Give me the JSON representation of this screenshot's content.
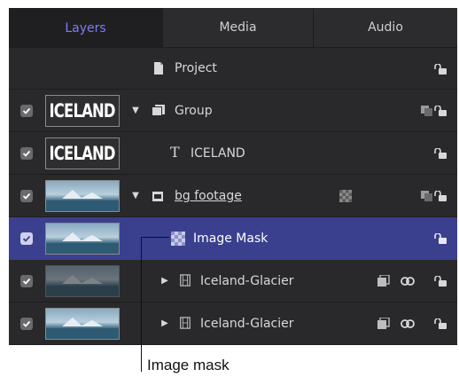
{
  "tabs": [
    {
      "label": "Layers",
      "active": true
    },
    {
      "label": "Media",
      "active": false
    },
    {
      "label": "Audio",
      "active": false
    }
  ],
  "rows": [
    {
      "name": "Project",
      "kind": "project",
      "icon": "document-icon",
      "has_checkbox": false
    },
    {
      "name": "Group",
      "kind": "group",
      "icon": "group-icon",
      "checked": true,
      "thumbnail_text": "ICELAND",
      "expanded": true
    },
    {
      "name": "ICELAND",
      "kind": "text",
      "icon": "text-layer-icon",
      "icon_glyph": "T",
      "checked": true,
      "thumbnail_text": "ICELAND"
    },
    {
      "name": "bg footage",
      "kind": "group",
      "icon": "group-icon",
      "checked": true,
      "thumbnail": "glacier-image",
      "expanded": true,
      "has_mask_badge": true
    },
    {
      "name": "Image Mask",
      "kind": "mask",
      "icon": "image-mask-icon",
      "checked": true,
      "thumbnail": "glacier-image",
      "selected": true
    },
    {
      "name": "Iceland-Glacier",
      "kind": "clip",
      "icon": "film-icon",
      "checked": true,
      "thumbnail": "glacier-image",
      "thumbnail_dim": true,
      "expanded": false
    },
    {
      "name": "Iceland-Glacier",
      "kind": "clip",
      "icon": "film-icon",
      "checked": true,
      "thumbnail": "glacier-image",
      "expanded": false
    }
  ],
  "callout": {
    "label": "Image mask"
  },
  "colors": {
    "accent": "#7b7cf6",
    "selection": "#3a3f8e",
    "panel": "#2a2a2c"
  }
}
